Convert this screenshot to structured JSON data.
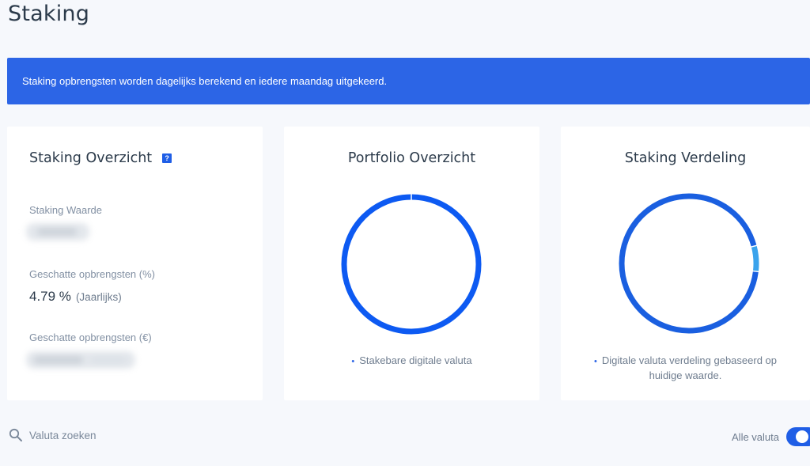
{
  "page": {
    "title": "Staking"
  },
  "banner": {
    "text": "Staking opbrengsten worden dagelijks berekend en iedere maandag uitgekeerd."
  },
  "overview": {
    "title": "Staking Overzicht",
    "help_icon": "?",
    "staking_value_label": "Staking Waarde",
    "estimated_pct_label": "Geschatte opbrengsten (%)",
    "estimated_pct_value": "4.79 %",
    "estimated_pct_period": "(Jaarlijks)",
    "estimated_eur_label": "Geschatte opbrengsten (€)"
  },
  "portfolio": {
    "title": "Portfolio Overzicht",
    "legend": "Stakebare digitale valuta",
    "ring_color": "#0d5af2",
    "ring_fraction": 1.0
  },
  "distribution": {
    "title": "Staking Verdeling",
    "legend_line1": "Digitale valuta verdeling gebaseerd op",
    "legend_line2": "huidige waarde.",
    "segments": [
      {
        "fraction": 0.94,
        "color": "#1a5fe0"
      },
      {
        "fraction": 0.06,
        "color": "#3aa3ec"
      }
    ]
  },
  "search": {
    "placeholder": "Valuta zoeken",
    "icon": "search-icon"
  },
  "filter": {
    "label": "Alle valuta",
    "enabled": true
  }
}
